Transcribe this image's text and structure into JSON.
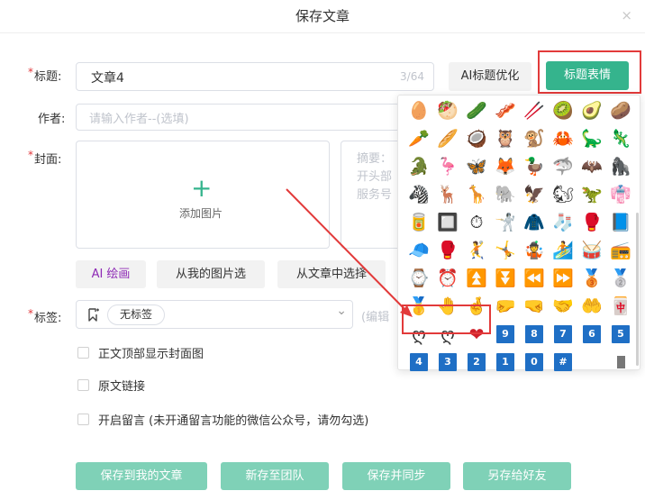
{
  "dialog": {
    "title": "保存文章",
    "close_glyph": "×"
  },
  "form": {
    "required_mark": "*",
    "title_label": "标题:",
    "title_value": "文章4",
    "title_count": "3/64",
    "ai_optimize_button": "AI标题优化",
    "title_emoji_button": "标题表情",
    "author_label": "作者:",
    "author_placeholder": "请输入作者--(选填)",
    "cover_label": "封面:",
    "add_image": "添加图片",
    "plus_glyph": "+",
    "summary_placeholder": [
      "摘要：",
      "开头部",
      "服务号"
    ],
    "ai_draw_button": "AI 绘画",
    "from_my_images_button": "从我的图片选",
    "from_article_button": "从文章中选择",
    "tags_label": "标签:",
    "tag_chip": "无标签",
    "tag_hint": "(编辑",
    "chevron_glyph": "⌄",
    "checkboxes": [
      "正文顶部显示封面图",
      "原文链接",
      "开启留言 (未开通留言功能的微信公众号，请勿勾选)"
    ]
  },
  "buttons": {
    "save_mine": "保存到我的文章",
    "save_team": "新存至团队",
    "save_sync": "保存并同步",
    "save_friend": "另存给好友"
  },
  "emoji_rows": [
    [
      "🥚",
      "🥙",
      "🥒",
      "🥓",
      "🥢",
      "🥝",
      "🥑",
      "🥔"
    ],
    [
      "🥕",
      "🥖",
      "🥥",
      "🦉",
      "🐒",
      "🦀",
      "🦕",
      "🦎"
    ],
    [
      "🐊",
      "🦩",
      "🦋",
      "🦊",
      "🦆",
      "🦈",
      "🦇",
      "🦍"
    ],
    [
      "🦓",
      "🦌",
      "🦒",
      "🐘",
      "🦅",
      "🐿",
      "🦖",
      "👘"
    ],
    [
      "🥫",
      "🔲",
      "⏱",
      "🤺",
      "🧥",
      "🧦",
      "🥊",
      "📘"
    ],
    [
      "🧢",
      "🥊",
      "🤾",
      "🤸",
      "🤹",
      "🏄",
      "🥁",
      "📻"
    ],
    [
      "⌚",
      "⏰",
      "⏫",
      "⏬",
      "⏪",
      "⏩",
      "🥉",
      "🥈"
    ],
    [
      "🥇",
      "🤚",
      "🤞",
      "🤛",
      "🤜",
      "🤝",
      "🤲",
      "🀄"
    ],
    [
      "ღ",
      "ღ",
      "❤"
    ]
  ],
  "keycaps_row9": [
    "9",
    "8",
    "7",
    "6",
    "5"
  ],
  "keycaps_row10": [
    "4",
    "3",
    "2",
    "1",
    "0",
    "#"
  ],
  "colors": {
    "accent_green": "#35b48d",
    "annotation_red": "#e23a3a",
    "keycap_blue": "#1f6fc5"
  }
}
